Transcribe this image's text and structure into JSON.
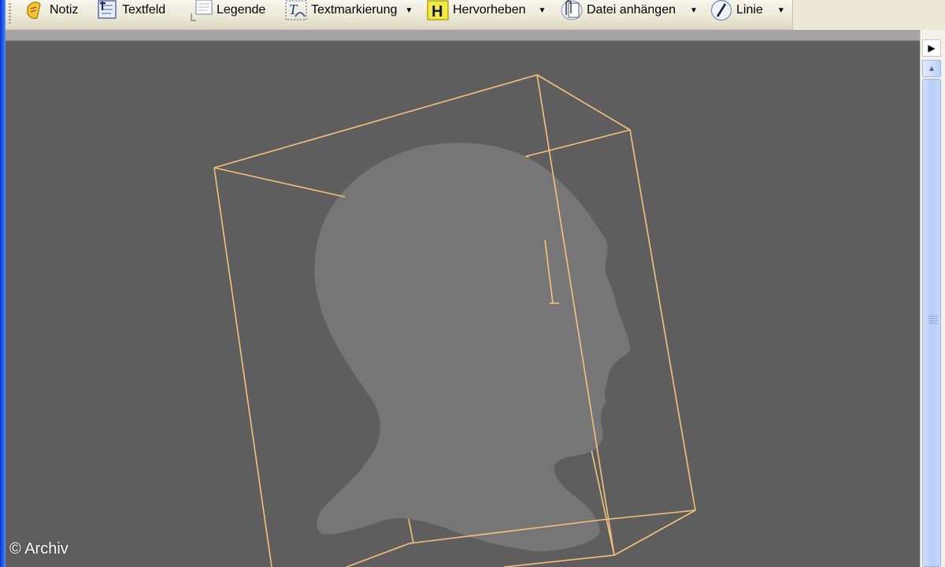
{
  "toolbar": {
    "items": [
      {
        "label": "Notiz",
        "icon": "note-icon",
        "has_dropdown": false
      },
      {
        "label": "Textfeld",
        "icon": "textbox-icon",
        "has_dropdown": false
      },
      {
        "label": "Legende",
        "icon": "callout-icon",
        "has_dropdown": false
      },
      {
        "label": "Textmarkierung",
        "icon": "text-markup-icon",
        "has_dropdown": true
      },
      {
        "label": "Hervorheben",
        "icon": "highlight-icon",
        "has_dropdown": true
      },
      {
        "label": "Datei anhängen",
        "icon": "attach-file-icon",
        "has_dropdown": true
      },
      {
        "label": "Linie",
        "icon": "line-icon",
        "has_dropdown": true
      }
    ]
  },
  "viewport": {
    "background": "#5e5e5e",
    "bounding_box_color": "#f5c27a",
    "head_silhouette_color": "#767676"
  },
  "watermark": "© Archiv"
}
